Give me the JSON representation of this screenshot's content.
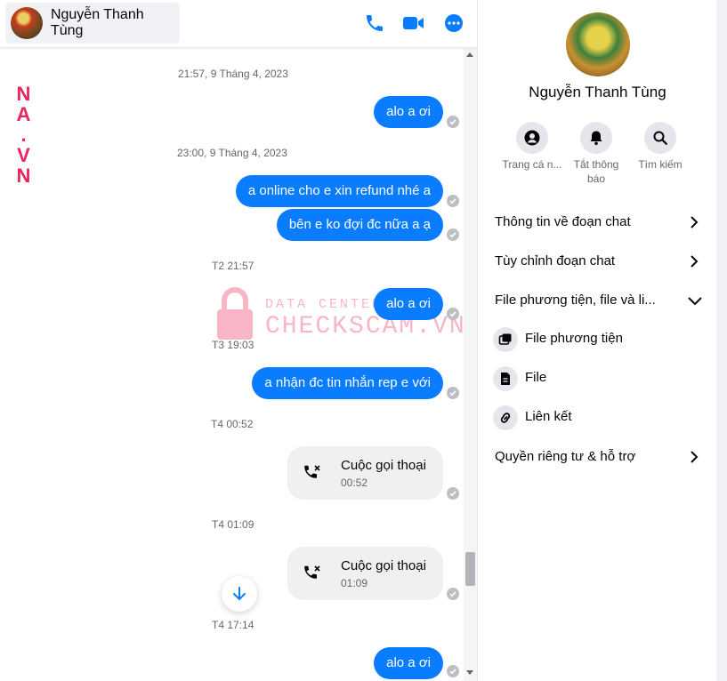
{
  "colors": {
    "accent": "#0a7cff",
    "bubble_bg": "#0a7cff",
    "call_bg": "#f0f0f0",
    "watermark": "#e8275c"
  },
  "header": {
    "contact_name": "Nguyễn Thanh Tùng",
    "icons": [
      "phone-icon",
      "video-icon",
      "more-icon"
    ]
  },
  "watermark": {
    "side_text": "N A . V N",
    "small_text": "DATA CENTER",
    "big_text": "CHECKSCAM.VN"
  },
  "messages": {
    "ts1": "21:57, 9 Tháng 4, 2023",
    "msg1": "alo a ơi",
    "ts2": "23:00, 9 Tháng 4, 2023",
    "msg2": "a online cho e xin refund nhé a",
    "msg3": "bên e ko đợi đc nữa a ạ",
    "ts3": "T2 21:57",
    "msg4": "alo a ơi",
    "ts4": "T3 19:03",
    "msg5": "a nhận đc tin nhắn rep e với",
    "ts5": "T4 00:52",
    "call1_title": "Cuộc gọi thoại",
    "call1_duration": "00:52",
    "ts6": "T4 01:09",
    "call2_title": "Cuộc gọi thoại",
    "call2_duration": "01:09",
    "ts7": "T4 17:14",
    "msg6": "alo a ơi"
  },
  "info": {
    "name": "Nguyễn Thanh Tùng",
    "actions": [
      {
        "label": "Trang cá n...",
        "icon": "profile-icon"
      },
      {
        "label": "Tắt thông báo",
        "icon": "bell-icon"
      },
      {
        "label": "Tìm kiếm",
        "icon": "search-icon"
      }
    ],
    "sections": {
      "chat_info": "Thông tin về đoạn chat",
      "customize": "Tùy chỉnh đoạn chat",
      "media_files": "File phương tiện, file và li...",
      "media": "File phương tiện",
      "files": "File",
      "links": "Liên kết",
      "privacy": "Quyền riêng tư & hỗ trợ"
    }
  }
}
